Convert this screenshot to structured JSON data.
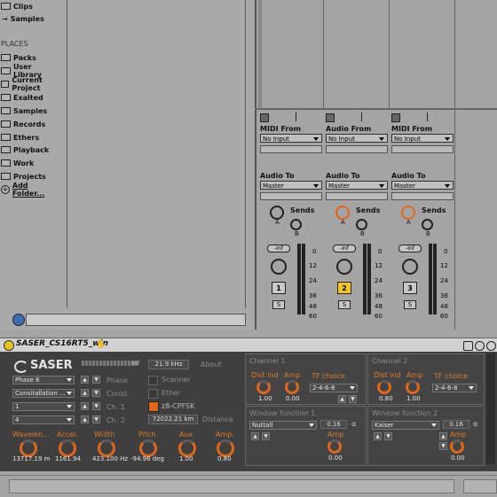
{
  "browser": {
    "top_items": [
      "Clips",
      "Samples"
    ],
    "places_header": "PLACES",
    "places": [
      "Packs",
      "User Library",
      "Current Project",
      "Exalted",
      "Samples",
      "Records",
      "Ethers",
      "Playback",
      "Work",
      "Projects"
    ],
    "add_folder": "Add Folder..."
  },
  "tracks": [
    {
      "midi_from_label": "MIDI From",
      "midi_from_value": "No Input",
      "audio_to_label": "Audio To",
      "audio_to_value": "Master",
      "sends_label": "Sends",
      "send_a": "A",
      "send_b": "B",
      "volume": "-Inf",
      "number": "1",
      "solo": "S",
      "selected": false
    },
    {
      "midi_from_label": "Audio From",
      "midi_from_value": "No Input",
      "audio_to_label": "Audio To",
      "audio_to_value": "Master",
      "sends_label": "Sends",
      "send_a": "A",
      "send_b": "B",
      "volume": "-Inf",
      "number": "2",
      "solo": "S",
      "selected": true
    },
    {
      "midi_from_label": "MIDI From",
      "midi_from_value": "No Input",
      "audio_to_label": "Audio To",
      "audio_to_value": "Master",
      "sends_label": "Sends",
      "send_a": "A",
      "send_b": "B",
      "volume": "-Inf",
      "number": "3",
      "solo": "S",
      "selected": false
    }
  ],
  "meter_scale": [
    "0",
    "12",
    "24",
    "36",
    "48",
    "60"
  ],
  "device": {
    "title": "SASER_CS16RT5_win",
    "logo": "SASER",
    "level_value": "-inf",
    "freq": "21.9 kHz",
    "about": "About",
    "phase_select": "Phase 6",
    "phase_label": "Phase",
    "const_select": "Consitallation ...",
    "const_label": "Const.",
    "ch1_select": "1",
    "ch1_label": "Ch. 1",
    "ch2_select": "4",
    "ch2_label": "Ch. 2",
    "scanner": "Scanner",
    "ether": "Ether",
    "cpfsk": "z8-CPFSK",
    "distance_value": "72022.21 km",
    "distance_label": "Distance",
    "knobs": [
      {
        "label": "Wavelen...",
        "value": "13717.19 m"
      },
      {
        "label": "Accel.",
        "value": "1161.94"
      },
      {
        "label": "Width",
        "value": "423.100 Hz"
      },
      {
        "label": "Pitch",
        "value": "-94.96 deg"
      },
      {
        "label": "Aux",
        "value": "1.00"
      },
      {
        "label": "Amp.",
        "value": "0.80"
      }
    ],
    "channel1": {
      "title": "Channel 1",
      "dist_label": "Dist ind",
      "dist_value": "1.00",
      "amp_label": "Amp",
      "amp_value": "0.00",
      "tf_label": "TF choice",
      "tf_value": "2-4-6-8"
    },
    "channel2": {
      "title": "Channel 2",
      "dist_label": "Dist ind",
      "dist_value": "0.80",
      "amp_label": "Amp",
      "amp_value": "1.00",
      "tf_label": "TF choice",
      "tf_value": "2-4-6-8"
    },
    "window1": {
      "title": "Window function 1",
      "select": "Nuttall",
      "value": "0.16",
      "alpha": "α",
      "amp_label": "Amp",
      "amp_value": "0.00"
    },
    "window2": {
      "title": "Window function 2",
      "select": "Kaiser",
      "value": "0.16",
      "alpha": "α",
      "amp_label": "Amp",
      "amp_value": "0.00"
    }
  },
  "colors": {
    "accent": "#e0671a",
    "selected_track": "#f5c518",
    "device_bg": "#3f3f3f"
  }
}
